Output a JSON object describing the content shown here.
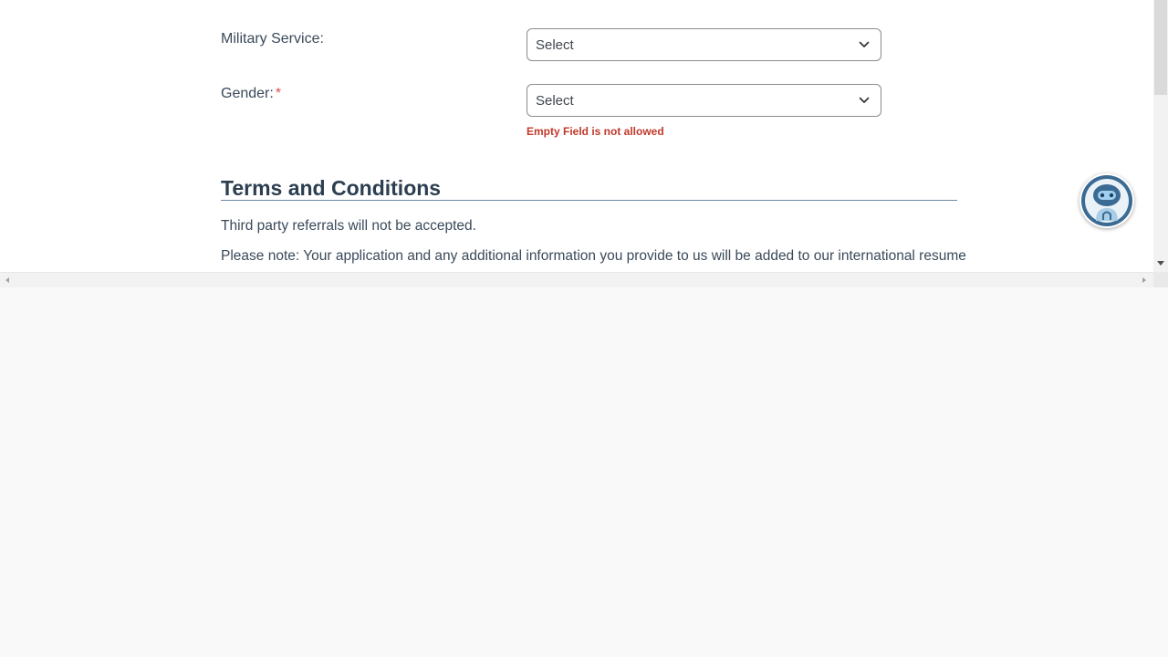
{
  "form": {
    "military_service": {
      "label": "Military Service:",
      "value": "Select"
    },
    "gender": {
      "label": "Gender:",
      "required_marker": "*",
      "value": "Select",
      "error": "Empty Field is not allowed"
    }
  },
  "terms": {
    "title": "Terms and Conditions",
    "paragraphs": [
      "Third party referrals will not be accepted.",
      "Please note: Your application and any additional information you provide to us will be added to our international resume"
    ]
  },
  "icons": {
    "select_chevron": "chevron-down-icon",
    "chatbot": "robot-icon",
    "scroll_down": "arrow-down-icon",
    "scroll_left": "arrow-left-icon",
    "scroll_right": "arrow-right-icon"
  },
  "colors": {
    "error": "#c0392b",
    "required": "#d9534f",
    "heading": "#2c3e50",
    "rule": "#6b87a3",
    "chatbot_primary": "#3b6a93"
  }
}
